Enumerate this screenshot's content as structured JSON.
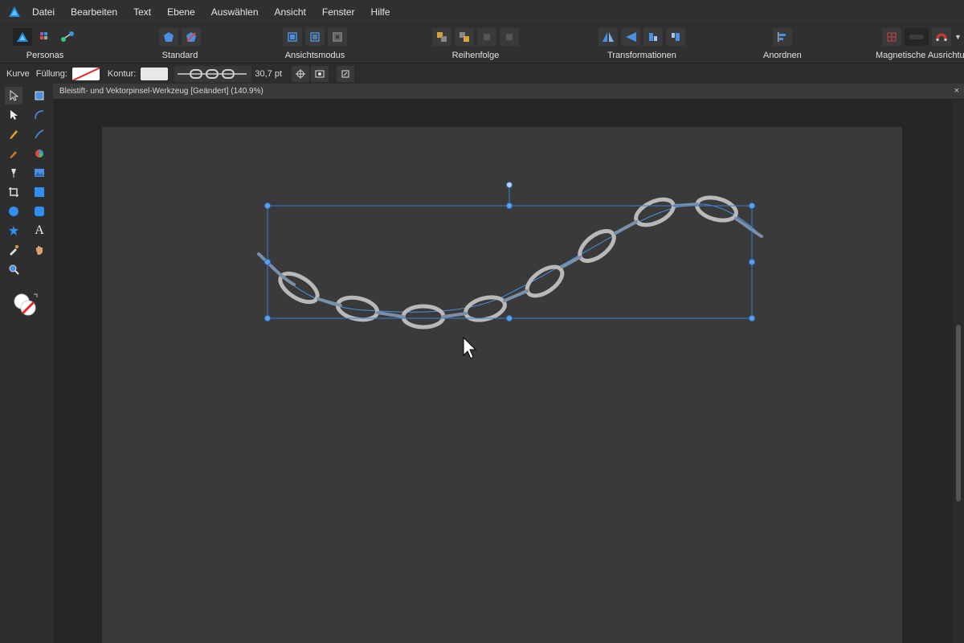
{
  "menu": {
    "items": [
      "Datei",
      "Bearbeiten",
      "Text",
      "Ebene",
      "Auswählen",
      "Ansicht",
      "Fenster",
      "Hilfe"
    ]
  },
  "toolbar": {
    "personas_label": "Personas",
    "standard_label": "Standard",
    "ansichtsmodus_label": "Ansichtsmodus",
    "reihenfolge_label": "Reihenfolge",
    "transformationen_label": "Transformationen",
    "anordnen_label": "Anordnen",
    "magnetische_label": "Magnetische Ausrichtung"
  },
  "context": {
    "tool_label": "Kurve",
    "fill_label": "Füllung:",
    "stroke_label": "Kontur:",
    "stroke_width": "30,7 pt"
  },
  "document": {
    "tab_title": "Bleistift- und Vektorpinsel-Werkzeug [Geändert] (140.9%)",
    "close_symbol": "×"
  },
  "colors": {
    "accent": "#4a90e2",
    "selection": "#3b7fd1",
    "handle_fill": "#5aa0ea",
    "background": "#2b2b2b",
    "artboard": "#3a3a3a"
  },
  "icons": {
    "app": "affinity-designer-icon",
    "tools": [
      "move-icon",
      "artboard-icon",
      "node-icon",
      "corner-icon",
      "pen-icon",
      "pencil-icon",
      "brush-icon",
      "fill-icon",
      "transparency-icon",
      "image-icon",
      "crop-icon",
      "rectangle-icon",
      "ellipse-icon",
      "rounded-rectangle-icon",
      "star-icon",
      "text-icon",
      "eyedropper-icon",
      "hand-icon",
      "zoom-icon",
      "color-swatch-icon"
    ]
  }
}
